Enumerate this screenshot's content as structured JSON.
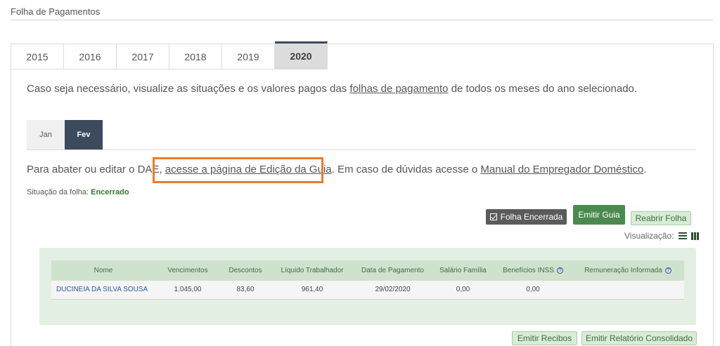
{
  "page": {
    "title": "Folha de Pagamentos"
  },
  "years": [
    "2015",
    "2016",
    "2017",
    "2018",
    "2019",
    "2020"
  ],
  "selected_year": "2020",
  "intro": {
    "before": "Caso seja necessário, visualize as situações e os valores pagos das ",
    "link": "folhas de pagamento",
    "after": " de todos os meses do ano selecionado."
  },
  "months": [
    "Jan",
    "Fev"
  ],
  "selected_month": "Fev",
  "help": {
    "before": "Para abater ou editar o DAE, ",
    "link1": "acesse a página de Edição da Guia",
    "middle": ". Em caso de dúvidas acesse o ",
    "link2": "Manual do Empregador Doméstico",
    "after": "."
  },
  "status": {
    "label": "Situação da folha: ",
    "value": "Encerrado"
  },
  "actions": {
    "closed_label": "Folha Encerrada",
    "issue_label": "Emitir Guia",
    "reopen_label": "Reabrir Folha"
  },
  "view": {
    "label": "Visualização:",
    "icons": [
      "list-icon",
      "grid-icon"
    ]
  },
  "table": {
    "headers": [
      "Nome",
      "Vencimentos",
      "Descontos",
      "Líquido Trabalhador",
      "Data de Pagamento",
      "Salário Família",
      "Benefícios INSS",
      "Remuneração Informada"
    ],
    "rows": [
      [
        "DUCINEIA DA SILVA SOUSA",
        "1.045,00",
        "83,60",
        "961,40",
        "29/02/2020",
        "0,00",
        "0,00",
        ""
      ]
    ]
  },
  "footer_actions": {
    "receipts_label": "Emitir Recibos",
    "report_label": "Emitir Relatório Consolidado"
  },
  "colors": {
    "accent_dark": "#3c4a5e",
    "green": "#4a8a4f",
    "highlight": "#ee7b2a"
  }
}
